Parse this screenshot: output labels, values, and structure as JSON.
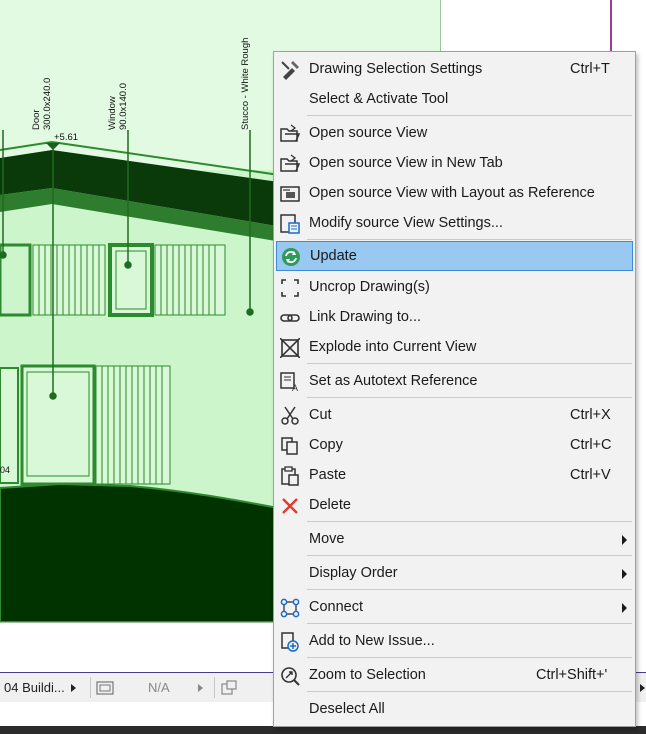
{
  "drawing": {
    "labels": {
      "door": [
        "Door",
        "300.0x240.0"
      ],
      "window": [
        "Window",
        "90.0x140.0"
      ],
      "stucco": "Stucco - White Rough",
      "elevation": "+5.61",
      "partial_number": "04"
    },
    "colors": {
      "light_green": "#ccf5cc",
      "mid_green": "#2e8a2e",
      "dark_green": "#003300",
      "panel_green": "#e2fae2"
    }
  },
  "statusbar": {
    "view_name": "04 Buildi...",
    "layer_value": "N/A"
  },
  "context_menu": {
    "items": [
      {
        "id": "drawing-selection-settings",
        "icon": "drawing-settings-icon",
        "label": "Drawing Selection Settings",
        "shortcut": "Ctrl+T"
      },
      {
        "id": "select-activate-tool",
        "icon": "",
        "label": "Select & Activate Tool",
        "shortcut": ""
      },
      {
        "id": "open-source-view",
        "icon": "open-folder-icon",
        "label": "Open source View",
        "shortcut": ""
      },
      {
        "id": "open-source-view-new-tab",
        "icon": "open-folder-icon",
        "label": "Open source View in New Tab",
        "shortcut": ""
      },
      {
        "id": "open-source-view-layout",
        "icon": "layout-reference-icon",
        "label": "Open source View with Layout as Reference",
        "shortcut": ""
      },
      {
        "id": "modify-source-view-settings",
        "icon": "view-settings-icon",
        "label": "Modify source View Settings...",
        "shortcut": ""
      },
      {
        "id": "update",
        "icon": "update-icon",
        "label": "Update",
        "shortcut": ""
      },
      {
        "id": "uncrop-drawing",
        "icon": "uncrop-icon",
        "label": "Uncrop Drawing(s)",
        "shortcut": ""
      },
      {
        "id": "link-drawing-to",
        "icon": "link-icon",
        "label": "Link Drawing to...",
        "shortcut": ""
      },
      {
        "id": "explode-into-current-view",
        "icon": "explode-icon",
        "label": "Explode into Current View",
        "shortcut": ""
      },
      {
        "id": "set-autotext-reference",
        "icon": "autotext-icon",
        "label": "Set as Autotext Reference",
        "shortcut": ""
      },
      {
        "id": "cut",
        "icon": "scissors-icon",
        "label": "Cut",
        "shortcut": "Ctrl+X"
      },
      {
        "id": "copy",
        "icon": "copy-icon",
        "label": "Copy",
        "shortcut": "Ctrl+C"
      },
      {
        "id": "paste",
        "icon": "paste-icon",
        "label": "Paste",
        "shortcut": "Ctrl+V"
      },
      {
        "id": "delete",
        "icon": "delete-icon",
        "label": "Delete",
        "shortcut": ""
      },
      {
        "id": "move",
        "icon": "",
        "label": "Move",
        "shortcut": ""
      },
      {
        "id": "display-order",
        "icon": "",
        "label": "Display Order",
        "shortcut": ""
      },
      {
        "id": "connect",
        "icon": "connect-icon",
        "label": "Connect",
        "shortcut": ""
      },
      {
        "id": "add-to-new-issue",
        "icon": "add-issue-icon",
        "label": "Add to New Issue...",
        "shortcut": ""
      },
      {
        "id": "zoom-to-selection",
        "icon": "zoom-selection-icon",
        "label": "Zoom to Selection",
        "shortcut": "Ctrl+Shift+'"
      },
      {
        "id": "deselect-all",
        "icon": "",
        "label": "Deselect All",
        "shortcut": ""
      }
    ],
    "highlighted": "Update",
    "submenu_items": [
      "Move",
      "Display Order",
      "Connect"
    ],
    "colors": {
      "background": "#f2f2f2",
      "highlight": "#99c9f0",
      "highlight_border": "#3b8ad8",
      "delete_icon": "#e03a2e",
      "update_icon": "#2e9a5e"
    }
  }
}
